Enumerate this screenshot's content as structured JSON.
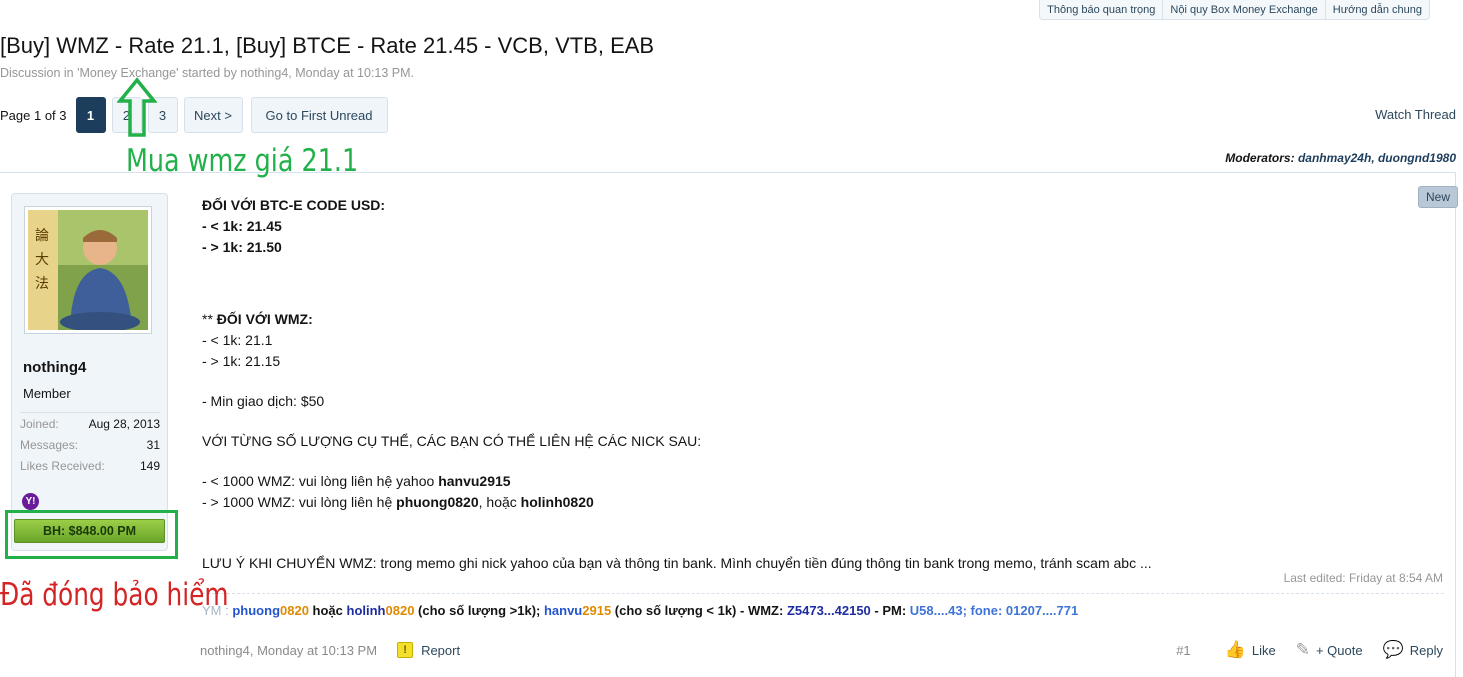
{
  "toplinks": [
    "Thông báo quan trọng",
    "Nội quy Box Money Exchange",
    "Hướng dẫn chung"
  ],
  "thread": {
    "title": "[Buy] WMZ - Rate 21.1, [Buy] BTCE - Rate 21.45 - VCB, VTB, EAB",
    "description": "Discussion in 'Money Exchange' started by nothing4, Monday at 10:13 PM."
  },
  "pagenav": {
    "label": "Page 1 of 3",
    "pages": [
      "1",
      "2",
      "3"
    ],
    "next": "Next >",
    "go_first_unread": "Go to First Unread"
  },
  "watch_thread": "Watch Thread",
  "moderators": {
    "label": "Moderators:",
    "names": "danhmay24h, duongnd1980"
  },
  "user": {
    "name": "nothing4",
    "title": "Member",
    "stats": [
      {
        "k": "Joined:",
        "v": "Aug 28, 2013"
      },
      {
        "k": "Messages:",
        "v": "31"
      },
      {
        "k": "Likes Received:",
        "v": "149"
      }
    ],
    "yahoo_glyph": "Y!",
    "insurance": "BH: $848.00 PM",
    "avatar_text": "論 大 法"
  },
  "new_tag": "New",
  "post": {
    "btce_heading": "ĐỐI VỚI BTC-E CODE USD:",
    "btce_l1": "- < 1k: 21.45",
    "btce_l2": "- > 1k: 21.50",
    "wmz_stars": "** ",
    "wmz_heading": "ĐỐI VỚI WMZ:",
    "wmz_l1": "- < 1k: 21.1",
    "wmz_l2": "- > 1k: 21.15",
    "min": "- Min giao dịch: $50",
    "contact_intro": "VỚI TỪNG SỐ LƯỢNG CỤ THỂ, CÁC BẠN CÓ THỂ LIÊN HỆ CÁC NICK SAU:",
    "c1_text": "- < 1000 WMZ: vui lòng liên hệ yahoo ",
    "c1_nick": "hanvu2915",
    "c2_text": "- > 1000 WMZ: vui lòng liên hệ ",
    "c2_nick1": "phuong0820",
    "c2_mid": ", hoặc ",
    "c2_nick2": "holinh0820",
    "note": "LƯU Ý KHI CHUYỂN WMZ: trong memo ghi nick yahoo của bạn và thông tin bank. Mình chuyển tiền đúng thông tin bank trong memo, tránh scam abc ..."
  },
  "last_edited": "Last edited: Friday at 8:54 AM",
  "signature": {
    "label": "YM :",
    "p1a": "phuong",
    "p1b": "0820",
    "or": " hoặc ",
    "p2a": "holinh",
    "p2b": "0820",
    "s1": " (cho số lượng >1k); ",
    "p3a": "hanvu",
    "p3b": "2915",
    "s2": " (cho số lượng < 1k) - WMZ: ",
    "wmz": "Z5473...42150",
    "s3": " - PM: ",
    "pm": "U58....43",
    "s4": "; ",
    "fone": "fone: 01207....771"
  },
  "footer": {
    "byline": "nothing4, Monday at 10:13 PM",
    "report": "Report",
    "report_glyph": "!",
    "post_number": "#1",
    "like": "Like",
    "quote": "+ Quote",
    "reply": "Reply",
    "like_glyph": "👍",
    "quote_glyph": "✎",
    "reply_glyph": "💬"
  },
  "annotations": {
    "arrow_color": "#22b04a",
    "green_text": "Mua wmz giá 21.1",
    "red_text": "Đã đóng bảo hiểm"
  }
}
